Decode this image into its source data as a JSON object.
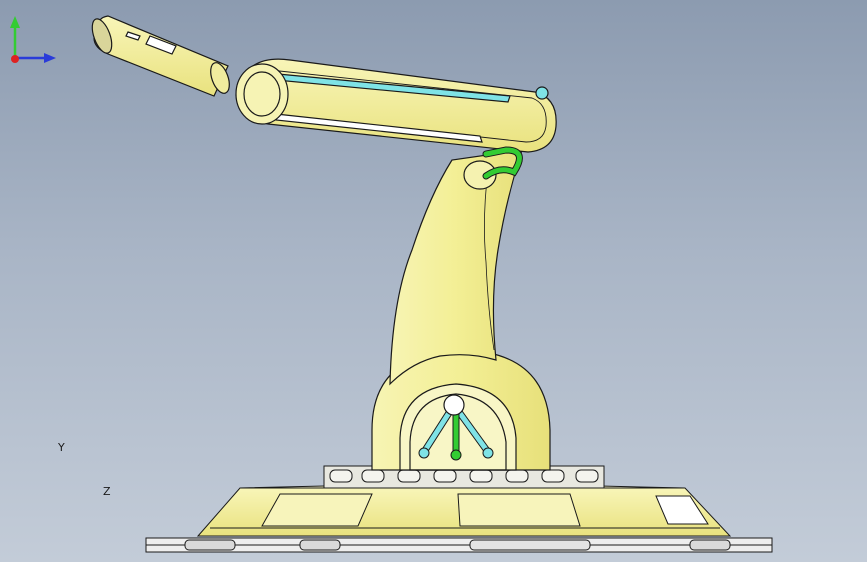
{
  "viewport": {
    "background_top": "#8c9bb0",
    "background_bottom": "#c3ccd8",
    "model_color": "#f3f09a",
    "outline_color": "#1a1a1a",
    "cyan_color": "#7fe3e6",
    "green_color": "#33cc33"
  },
  "triad": {
    "y_label": "Y",
    "z_label": "Z",
    "y_color": "#33cc33",
    "z_color": "#2a3bd9",
    "x_color": "#dd2222"
  }
}
